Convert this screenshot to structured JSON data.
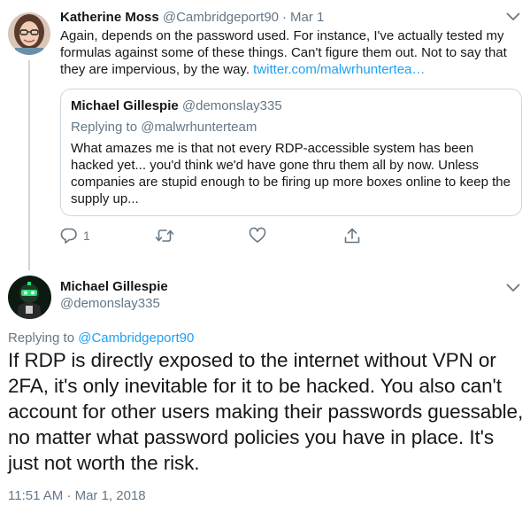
{
  "tweet1": {
    "name": "Katherine Moss",
    "handle": "@Cambridgeport90",
    "separator": "·",
    "time": "Mar 1",
    "text": "Again, depends on the password used. For instance, I've actually tested my formulas against some of these things. Can't figure them out. Not to say that they are impervious, by the way. ",
    "link": "twitter.com/malwrhuntertea…",
    "quote": {
      "name": "Michael Gillespie",
      "handle": "@demonslay335",
      "replying_prefix": "Replying to ",
      "replying_handle": "@malwrhunterteam",
      "text": "What amazes me is that not every RDP-accessible system has been hacked yet... you'd think we'd have gone thru them all by now. Unless companies are stupid enough to be firing up more boxes online to keep the supply up..."
    },
    "actions": {
      "reply_count": "1",
      "reply_icon": "reply-icon",
      "retweet_icon": "retweet-icon",
      "like_icon": "heart-icon",
      "share_icon": "share-icon"
    }
  },
  "tweet2": {
    "name": "Michael Gillespie",
    "handle": "@demonslay335",
    "replying_prefix": "Replying to ",
    "replying_handle": "@Cambridgeport90",
    "text": "If RDP is directly exposed to the internet without VPN or 2FA, it's only inevitable for it to be hacked. You also can't account for other users making their passwords guessable, no matter what password policies you have in place. It's just not worth the risk.",
    "timestamp": "11:51 AM · Mar 1, 2018"
  },
  "colors": {
    "text": "#14171a",
    "secondary": "#657786",
    "link": "#1da1f2",
    "border": "#ccd6dd"
  }
}
